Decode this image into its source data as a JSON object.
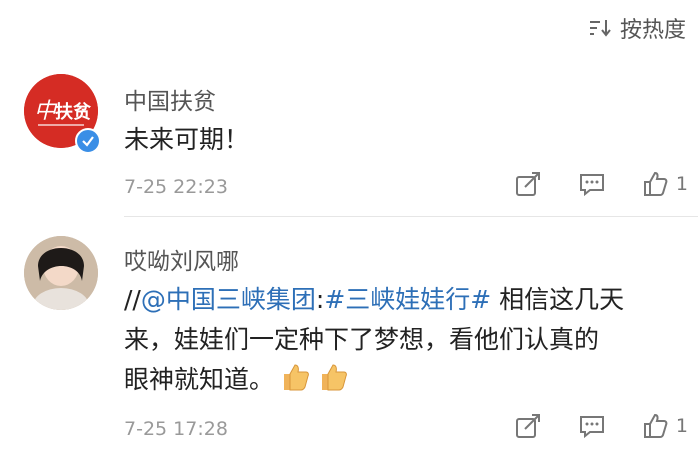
{
  "sort": {
    "label": "按热度"
  },
  "comments": [
    {
      "username": "中国扶贫",
      "text": "未来可期！",
      "time": "7-25 22:23",
      "likes": "1",
      "verified": true,
      "avatar_text": "扶贫"
    },
    {
      "username": "哎呦刘风哪",
      "text_prefix": "//",
      "mention": "@中国三峡集团",
      "colon": ":",
      "topic": "#三峡娃娃行#",
      "text_line1_rest": " 相信这几天",
      "text_line2": "来，娃娃们一定种下了梦想，看他们认真的",
      "text_line3": "眼神就知道。",
      "time": "7-25 17:28",
      "likes": "1"
    }
  ],
  "icons": [
    "sort-icon",
    "share-icon",
    "comment-icon",
    "like-icon",
    "thumbs-up-emoji"
  ]
}
